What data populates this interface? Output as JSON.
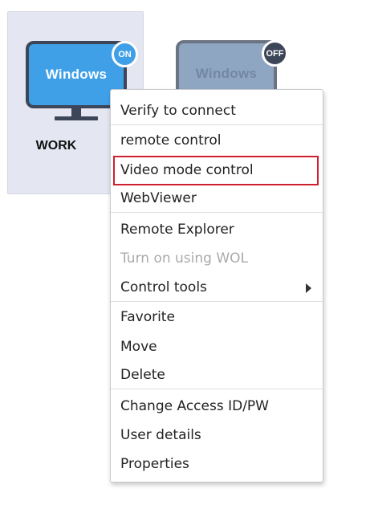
{
  "devices": [
    {
      "name": "WORK",
      "monitor_label": "Windows",
      "status": "ON",
      "selected": true
    },
    {
      "name": "",
      "monitor_label": "Windows",
      "status": "OFF",
      "selected": false
    }
  ],
  "context_menu": {
    "items": [
      {
        "label": "Verify to connect",
        "disabled": false
      },
      {
        "label": "remote control",
        "disabled": false
      },
      {
        "label": "Video mode control",
        "disabled": false,
        "highlighted": true
      },
      {
        "label": "WebViewer",
        "disabled": false
      },
      {
        "label": "Remote Explorer",
        "disabled": false
      },
      {
        "label": "Turn on using WOL",
        "disabled": true
      },
      {
        "label": "Control tools",
        "disabled": false,
        "has_submenu": true
      },
      {
        "label": "Favorite",
        "disabled": false
      },
      {
        "label": "Move",
        "disabled": false
      },
      {
        "label": "Delete",
        "disabled": false
      },
      {
        "label": "Change Access ID/PW",
        "disabled": false
      },
      {
        "label": "User details",
        "disabled": false
      },
      {
        "label": "Properties",
        "disabled": false
      }
    ],
    "submenu_icon": "chevron-right-icon"
  },
  "colors": {
    "accent": "#3fa0e8",
    "highlight_border": "#d0202e",
    "disabled_text": "#aaaaaa",
    "card_bg": "#e4e7f1"
  }
}
